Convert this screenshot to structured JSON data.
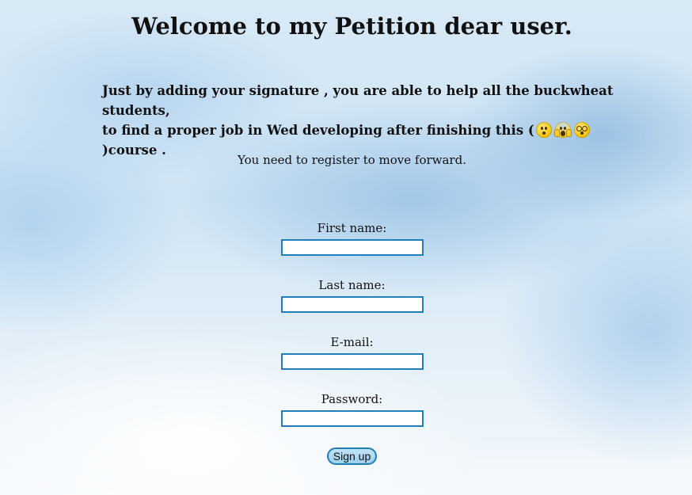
{
  "page": {
    "title": "Welcome to my Petition dear user.",
    "intro_line1": "Just by adding your signature , you are able to help all the buckwheat students,",
    "intro_line2_before": "to find a proper job in Wed developing after finishing this (",
    "intro_line2_after": ")course .",
    "intro_emojis": [
      "confused-face",
      "screaming-face",
      "dizzy-face"
    ],
    "subtitle": "You need to register to move forward."
  },
  "form": {
    "first_name_label": "First name:",
    "first_name_value": "",
    "last_name_label": "Last name:",
    "last_name_value": "",
    "email_label": "E-mail:",
    "email_value": "",
    "password_label": "Password:",
    "password_value": "",
    "submit_label": "Sign up"
  },
  "colors": {
    "input_border": "#1f7fb8",
    "background": "#cfe4f4"
  }
}
